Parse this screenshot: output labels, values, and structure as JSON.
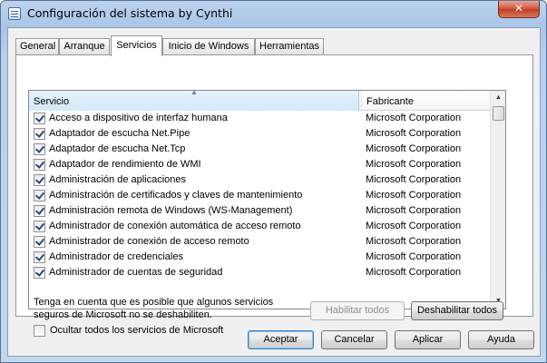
{
  "window": {
    "title": "Configuración del sistema by Cynthi",
    "close_glyph": "✕"
  },
  "tabs": [
    {
      "label": "General"
    },
    {
      "label": "Arranque"
    },
    {
      "label": "Servicios"
    },
    {
      "label": "Inicio de Windows"
    },
    {
      "label": "Herramientas"
    }
  ],
  "active_tab": "Servicios",
  "list": {
    "columns": {
      "service": "Servicio",
      "manufacturer": "Fabricante"
    },
    "sort_indicator": "▲",
    "rows": [
      {
        "service": "Acceso a dispositivo de interfaz humana",
        "manufacturer": "Microsoft Corporation",
        "checked": true
      },
      {
        "service": "Adaptador de escucha Net.Pipe",
        "manufacturer": "Microsoft Corporation",
        "checked": true
      },
      {
        "service": "Adaptador de escucha Net.Tcp",
        "manufacturer": "Microsoft Corporation",
        "checked": true
      },
      {
        "service": "Adaptador de rendimiento de WMI",
        "manufacturer": "Microsoft Corporation",
        "checked": true
      },
      {
        "service": "Administración de aplicaciones",
        "manufacturer": "Microsoft Corporation",
        "checked": true
      },
      {
        "service": "Administración de certificados y claves de mantenimiento",
        "manufacturer": "Microsoft Corporation",
        "checked": true
      },
      {
        "service": "Administración remota de Windows (WS-Management)",
        "manufacturer": "Microsoft Corporation",
        "checked": true
      },
      {
        "service": "Administrador de conexión automática de acceso remoto",
        "manufacturer": "Microsoft Corporation",
        "checked": true
      },
      {
        "service": "Administrador de conexión de acceso remoto",
        "manufacturer": "Microsoft Corporation",
        "checked": true
      },
      {
        "service": "Administrador de credenciales",
        "manufacturer": "Microsoft Corporation",
        "checked": true
      },
      {
        "service": "Administrador de cuentas de seguridad",
        "manufacturer": "Microsoft Corporation",
        "checked": true
      }
    ],
    "scroll_up_glyph": "▲",
    "scroll_down_glyph": "▼"
  },
  "note": "Tenga en cuenta que es posible que algunos servicios seguros de Microsoft no se deshabiliten.",
  "buttons": {
    "enable_all": "Habilitar todos",
    "disable_all": "Deshabilitar todos",
    "ok": "Aceptar",
    "cancel": "Cancelar",
    "apply": "Aplicar",
    "help": "Ayuda"
  },
  "hide_ms_label": "Ocultar todos los servicios de Microsoft",
  "hide_ms_checked": false,
  "icons": {
    "app": "system-config-icon",
    "close": "close-icon",
    "checkbox": "checkbox-icon"
  },
  "colors": {
    "title_bar": "#b8cfec",
    "close_button": "#c13d22",
    "header_highlight": "#d3e9f8",
    "default_button_border": "#3c7fb1"
  }
}
